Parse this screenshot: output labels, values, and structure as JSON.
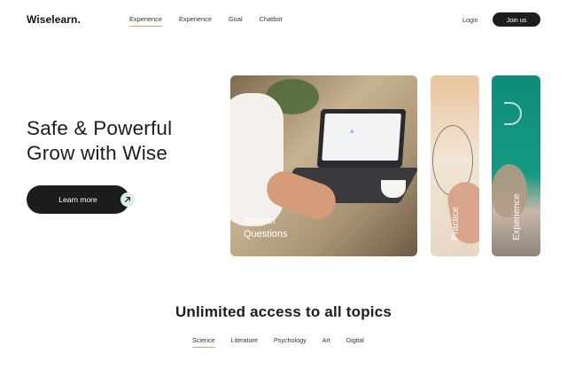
{
  "brand": {
    "logo": "Wiselearn."
  },
  "nav": {
    "items": [
      {
        "label": "Experience",
        "active": true
      },
      {
        "label": "Experience",
        "active": false
      },
      {
        "label": "Goal",
        "active": false
      },
      {
        "label": "Chatbot",
        "active": false
      }
    ],
    "login": "Login",
    "join": "Join us"
  },
  "hero": {
    "title_line1": "Safe & Powerful",
    "title_line2": "Grow with Wise",
    "cta": "Learn more",
    "cta_icon": "arrow-up-right-icon"
  },
  "cards": [
    {
      "label_line1": "Answer",
      "label_line2": "Questions"
    },
    {
      "label": "Practice"
    },
    {
      "label": "Experience"
    }
  ],
  "section": {
    "title": "Unlimited access to all topics",
    "topics": [
      {
        "label": "Science",
        "active": true
      },
      {
        "label": "Literature",
        "active": false
      },
      {
        "label": "Psychology",
        "active": false
      },
      {
        "label": "Art",
        "active": false
      },
      {
        "label": "Digital",
        "active": false
      }
    ]
  },
  "colors": {
    "accent": "#e9a35c",
    "dark": "#1c1c1c",
    "mint": "#dcefe4",
    "teal": "#0f8c78"
  }
}
